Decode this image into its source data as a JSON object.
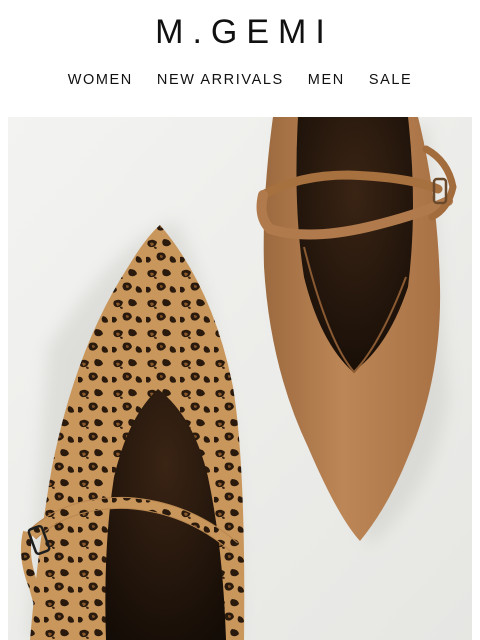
{
  "brand": {
    "logo_text": "M.GEMI"
  },
  "nav": {
    "items": [
      {
        "label": "WOMEN"
      },
      {
        "label": "NEW ARRIVALS"
      },
      {
        "label": "MEN"
      },
      {
        "label": "SALE"
      }
    ]
  },
  "hero": {
    "image": "leopard-print-and-tan-leather-pointed-mary-jane-flats",
    "colors": {
      "tan_leather": "#b07a4c",
      "background": "#eeeeec",
      "leopard_base": "#c8955a"
    }
  }
}
